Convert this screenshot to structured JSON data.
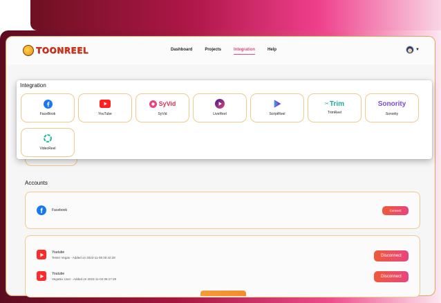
{
  "brand": {
    "logo_text": "TOONREEL"
  },
  "nav": {
    "items": [
      {
        "label": "Dashboard"
      },
      {
        "label": "Projects"
      },
      {
        "label": "Integration"
      },
      {
        "label": "Help"
      }
    ],
    "active": "Integration"
  },
  "integration": {
    "title": "Integration",
    "tiles": [
      {
        "label": "FaceBook",
        "icon": "facebook-icon"
      },
      {
        "label": "YouTube",
        "icon": "youtube-icon"
      },
      {
        "label": "SyVid",
        "icon": "syvid-logo",
        "logo_text": "SyVid"
      },
      {
        "label": "LiveReel",
        "icon": "livereel-icon"
      },
      {
        "label": "ScriptReel",
        "icon": "scriptreel-icon"
      },
      {
        "label": "TrimReel",
        "icon": "trimreel-logo",
        "logo_text": "Trim"
      },
      {
        "label": "Sonority",
        "icon": "sonority-logo",
        "logo_text": "Sonority"
      },
      {
        "label": "VideoReel",
        "icon": "videoreel-icon"
      }
    ]
  },
  "accounts": {
    "title": "Accounts",
    "facebook": {
      "name": "Facebook",
      "button": "Connect"
    },
    "youtube": [
      {
        "name": "Youtube",
        "detail": "Tester Vegas - Added on 2023-11-08 00:42:28",
        "button": "Disconnect"
      },
      {
        "name": "Youtube",
        "detail": "VegaSix User - Added on 2023-11-04 06:17:29",
        "button": "Disconnect"
      }
    ]
  },
  "colors": {
    "accent": "#e8457d",
    "tile_border": "#f0c98c",
    "button_gradient_start": "#ef5a3a",
    "button_gradient_end": "#e8457d"
  }
}
